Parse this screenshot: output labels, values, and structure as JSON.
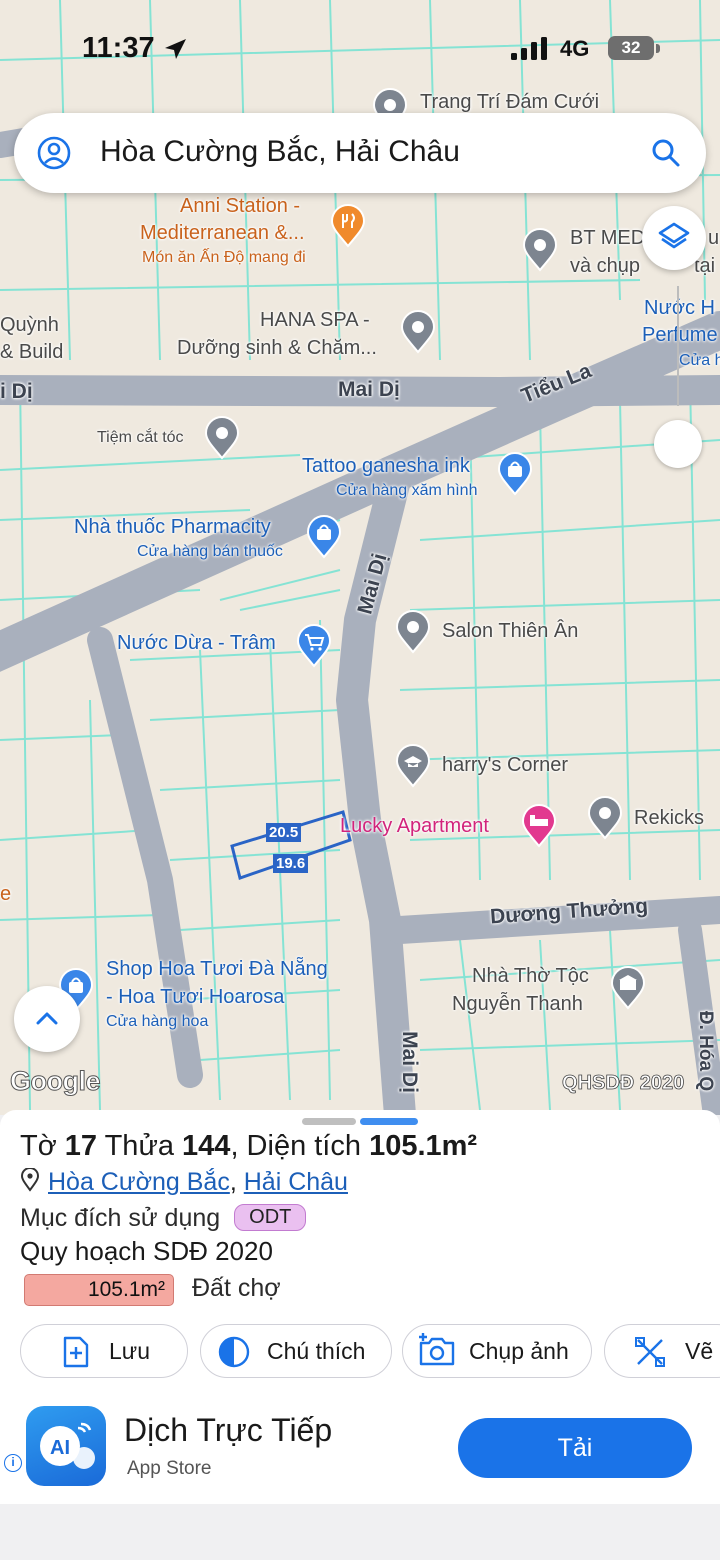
{
  "status_bar": {
    "time": "11:37",
    "network": "4G",
    "battery": "32"
  },
  "search": {
    "text": "Hòa Cường Bắc, Hải Châu"
  },
  "map": {
    "roads": {
      "mai_di_top": "Mai Dị",
      "mai_di_left": "i Dị",
      "tieu_la": "Tiểu La",
      "mai_di_vertical": "Mai Dị",
      "duong_thuong": "Dương Thưởng",
      "mai_di_bottom": "Mai Dị",
      "d_hoa": "Đ. Hóa Q"
    },
    "pois": {
      "trang_tri": "Trang Trí Đám Cưới",
      "anni_1": "Anni Station -",
      "anni_2": "Mediterranean &...",
      "anni_sub": "Món ăn Ấn Độ mang đi",
      "bt_med_1": "BT MED",
      "bt_med_1b": "u",
      "bt_med_2": "và chụp",
      "bt_med_2b": "tại",
      "quynh_1": "Quỳnh",
      "quynh_2": "& Build",
      "hana_1": "HANA SPA -",
      "hana_2": "Dưỡng sinh & Chăm...",
      "nuoc_hoa_1": "Nước H",
      "nuoc_hoa_2": "Perfume",
      "nuoc_hoa_3": "Cửa h",
      "tiem_cat_toc": "Tiệm cắt tóc",
      "tattoo": "Tattoo ganesha ink",
      "tattoo_sub": "Cửa hàng xăm hình",
      "pharmacity": "Nhà thuốc Pharmacity",
      "pharmacity_sub": "Cửa hàng bán thuốc",
      "nuoc_dua": "Nước Dừa - Trâm",
      "salon": "Salon Thiên Ân",
      "harrys": "harry's Corner",
      "lucky": "Lucky Apartment",
      "rekicks": "Rekicks",
      "shop_hoa_1": "Shop Hoa Tươi Đà Nẵng",
      "shop_hoa_2": "- Hoa Tươi Hoarosa",
      "shop_hoa_sub": "Cửa hàng hoa",
      "nha_tho_1": "Nhà Thờ Tộc",
      "nha_tho_2": "Nguyễn Thanh",
      "edge_e": "e"
    },
    "dimensions": {
      "top": "20.5",
      "bottom": "19.6"
    },
    "google_logo": "Google",
    "layer_badge": "QHSDĐ 2020"
  },
  "parcel": {
    "title_prefix": "Tờ ",
    "sheet_no": "17",
    "title_mid": " Thửa ",
    "plot_no": "144",
    "title_area_label": ", Diện tích ",
    "area": "105.1m²",
    "ward": "Hòa Cường Bắc",
    "district": "Hải Châu",
    "purpose_label": "Mục đích sử dụng",
    "purpose_code": "ODT",
    "plan_label": "Quy hoạch SDĐ 2020",
    "plan_area": "105.1m²",
    "plan_land_type": "Đất chợ"
  },
  "actions": {
    "save": "Lưu",
    "legend": "Chú thích",
    "capture": "Chụp ảnh",
    "draw": "Vẽ"
  },
  "ad": {
    "title": "Dịch Trực Tiếp",
    "subtitle": "App Store",
    "cta": "Tải",
    "info": "i",
    "icon_text": "AI"
  },
  "colors": {
    "accent": "#1a73e8",
    "road": "#a9b0bd",
    "parcel_line": "#6fe0d0",
    "map_bg": "#efe9df",
    "area_bar": "#f4a8a0",
    "badge": "#eac0f0"
  }
}
